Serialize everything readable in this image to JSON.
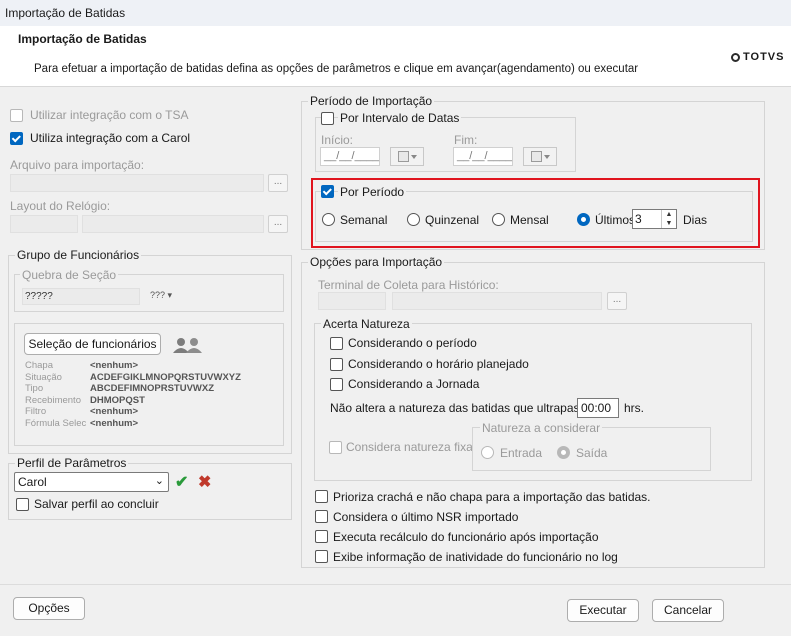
{
  "window": {
    "title": "Importação de Batidas"
  },
  "header": {
    "title": "Importação de Batidas",
    "description": "Para efetuar a importação de batidas defina as opções de parâmetros e clique em avançar(agendamento) ou executar",
    "logo": "TOTVS"
  },
  "left": {
    "tsa_label": "Utilizar integração com o TSA",
    "tsa_checked": false,
    "carol_label": "Utiliza integração com a Carol",
    "carol_checked": true,
    "arquivo_label": "Arquivo para importação:",
    "layout_label": "Layout do Relógio:",
    "dots": "...",
    "grupo": {
      "title": "Grupo de Funcionários",
      "quebra_title": "Quebra de Seção",
      "quebra_value": "?????",
      "quebra_btn": "???",
      "selecao_button": "Seleção de funcionários",
      "rows": [
        {
          "label": "Chapa",
          "value": "<nenhum>"
        },
        {
          "label": "Situação",
          "value": "ACDEFGIKLMNOPQRSTUVWXYZ"
        },
        {
          "label": "Tipo",
          "value": "ABCDEFIMNOPRSTUVWXZ"
        },
        {
          "label": "Recebimento",
          "value": "DHMOPQST"
        },
        {
          "label": "Filtro",
          "value": "<nenhum>"
        },
        {
          "label": "Fórmula Selec",
          "value": "<nenhum>"
        }
      ]
    },
    "perfil": {
      "title": "Perfil de Parâmetros",
      "selected": "Carol",
      "salvar_label": "Salvar perfil ao concluir"
    }
  },
  "periodo": {
    "title": "Período de Importação",
    "intervalo_label": "Por Intervalo de Datas",
    "inicio_label": "Início:",
    "fim_label": "Fim:",
    "date_placeholder": "__/__/____",
    "por_periodo_label": "Por Período",
    "options": [
      "Semanal",
      "Quinzenal",
      "Mensal",
      "Últimos"
    ],
    "selected_option": "Últimos",
    "ultimos_value": "3",
    "dias_label": "Dias",
    "highlight_color": "#e0141e"
  },
  "opcoes": {
    "title": "Opções para Importação",
    "terminal_label": "Terminal de Coleta para Histórico:",
    "acerta": {
      "title": "Acerta Natureza",
      "items": [
        "Considerando o período",
        "Considerando o horário planejado",
        "Considerando a Jornada"
      ],
      "nao_altera_label": "Não altera a natureza das batidas que ultrapassem",
      "time_value": "00:00",
      "hrs_label": "hrs.",
      "considera_fixa_label": "Considera natureza fixa",
      "natureza_title": "Natureza a considerar",
      "entrada_label": "Entrada",
      "saida_label": "Saída"
    },
    "checks": [
      "Prioriza crachá e não chapa para a importação das batidas.",
      "Considera o último NSR importado",
      "Executa recálculo do funcionário após importação",
      "Exibe informação de inatividade do funcionário no log"
    ]
  },
  "footer": {
    "opcoes_button": "Opções",
    "executar_button": "Executar",
    "cancelar_button": "Cancelar"
  }
}
